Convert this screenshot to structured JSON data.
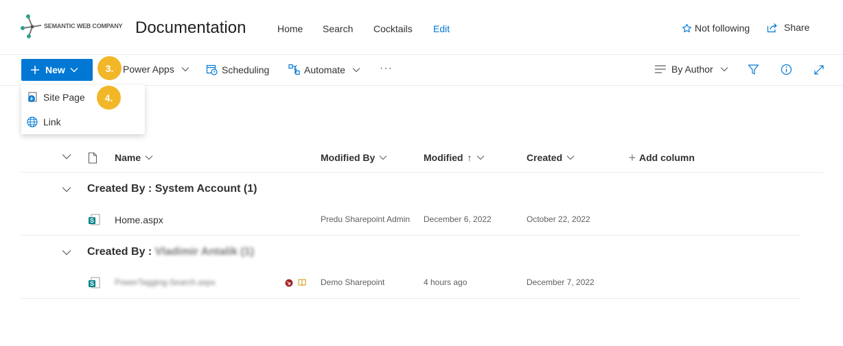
{
  "header": {
    "logo_text": "SEMANTIC WEB COMPANY",
    "site_title": "Documentation",
    "nav": [
      "Home",
      "Search",
      "Cocktails",
      "Edit"
    ],
    "follow_label": "Not following",
    "share_label": "Share"
  },
  "commandbar": {
    "new_label": "New",
    "power_apps_label": "Power Apps",
    "scheduling_label": "Scheduling",
    "automate_label": "Automate",
    "more_label": "···",
    "view_label": "By Author"
  },
  "badges": [
    "3.",
    "4."
  ],
  "new_menu": {
    "items": [
      "Site Page",
      "Link"
    ]
  },
  "columns": {
    "name": "Name",
    "modified_by": "Modified By",
    "modified": "Modified",
    "modified_sort": "↑",
    "created": "Created",
    "add_column": "Add column"
  },
  "groups": [
    {
      "label": "Created By : System Account (1)",
      "files": [
        {
          "name": "Home.aspx",
          "modified_by": "Predu Sharepoint Admin",
          "modified": "December 6, 2022",
          "created": "October 22, 2022"
        }
      ]
    },
    {
      "label_prefix": "Created By :",
      "label_blurred": "Vladimir Antalik (1)",
      "files": [
        {
          "name": "PowerTagging-Search.aspx",
          "modified_by": "Demo Sharepoint",
          "modified": "4 hours ago",
          "created": "December 7, 2022"
        }
      ]
    }
  ],
  "colors": {
    "accent": "#0078d4",
    "badge": "#f2b728",
    "sharepoint_green": "#038387",
    "text": "#323130"
  }
}
